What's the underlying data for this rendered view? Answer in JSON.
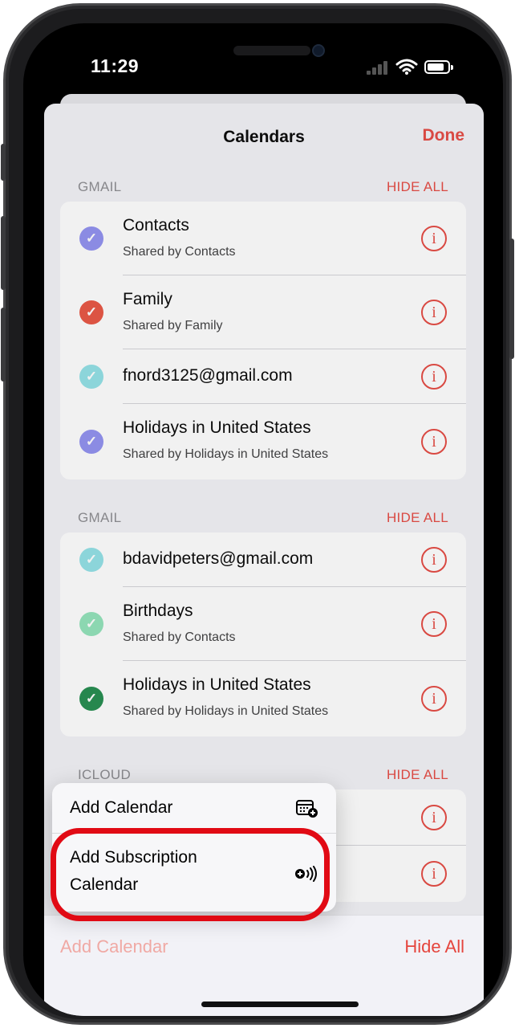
{
  "status_bar": {
    "time": "11:29"
  },
  "header": {
    "title": "Calendars",
    "done_label": "Done"
  },
  "sections": [
    {
      "label": "GMAIL",
      "action": "HIDE ALL",
      "items": [
        {
          "name": "Contacts",
          "sub": "Shared by Contacts",
          "color": "#8e8ef0",
          "checked": true
        },
        {
          "name": "Family",
          "sub": "Shared by Family",
          "color": "#e8513e",
          "checked": true
        },
        {
          "name": "fnord3125@gmail.com",
          "sub": "",
          "color": "#8fe0e6",
          "checked": true
        },
        {
          "name": "Holidays in United States",
          "sub": "Shared by Holidays in United States",
          "color": "#8e8ef0",
          "checked": true
        }
      ]
    },
    {
      "label": "GMAIL",
      "action": "HIDE ALL",
      "items": [
        {
          "name": "bdavidpeters@gmail.com",
          "sub": "",
          "color": "#8fe0e6",
          "checked": true
        },
        {
          "name": "Birthdays",
          "sub": "Shared by Contacts",
          "color": "#8fe2b8",
          "checked": true
        },
        {
          "name": "Holidays in United States",
          "sub": "Shared by Holidays in United States",
          "color": "#1e8a4a",
          "checked": true
        }
      ]
    },
    {
      "label": "ICLOUD",
      "action": "HIDE ALL",
      "items": []
    }
  ],
  "popup_menu": {
    "items": [
      {
        "label": "Add Calendar",
        "icon": "calendar-add-icon"
      },
      {
        "label_line1": "Add Subscription",
        "label_line2": "Calendar",
        "icon": "subscription-broadcast-icon"
      }
    ]
  },
  "toolbar": {
    "add_label": "Add Calendar",
    "hide_label": "Hide All"
  },
  "colors": {
    "accent": "#e5453d",
    "highlight_ring": "#e10a14"
  }
}
